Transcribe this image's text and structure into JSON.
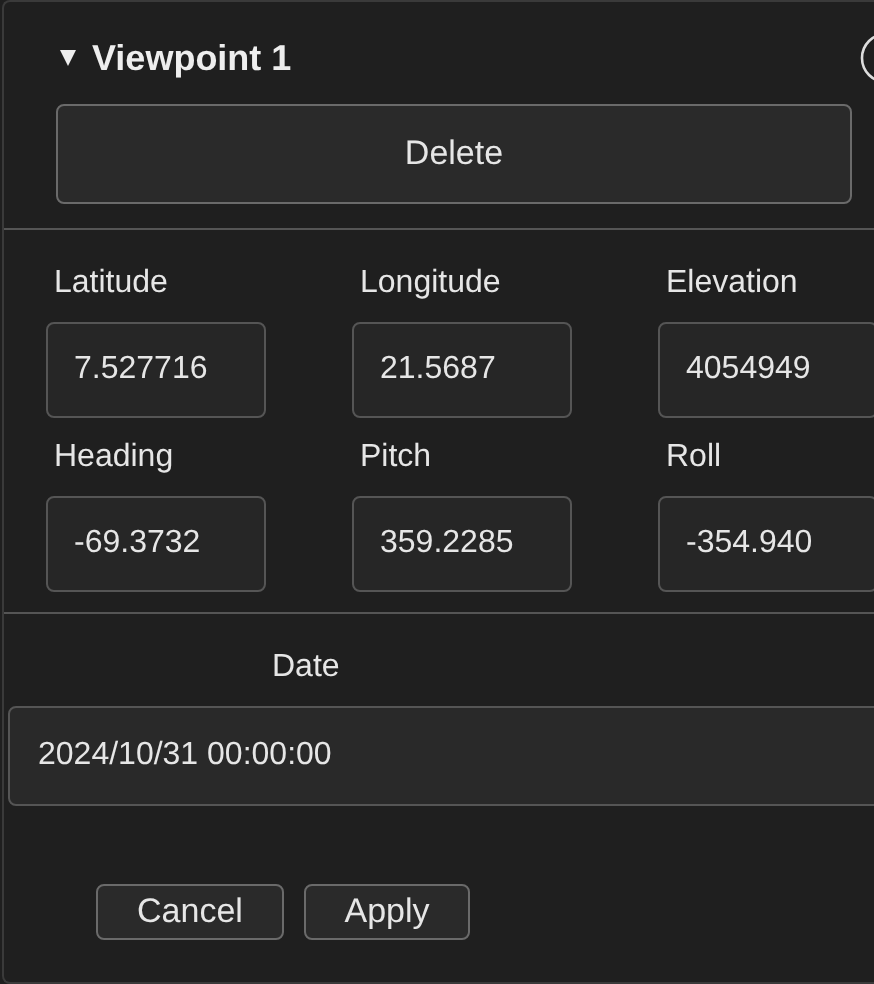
{
  "section": {
    "title": "Viewpoint 1",
    "expanded": true,
    "delete_button": "Delete"
  },
  "fields": [
    {
      "label": "Latitude",
      "value": "7.527716"
    },
    {
      "label": "Longitude",
      "value": "21.5687"
    },
    {
      "label": "Elevation",
      "value": "4054949"
    },
    {
      "label": "Heading",
      "value": "-69.3732"
    },
    {
      "label": "Pitch",
      "value": "359.2285"
    },
    {
      "label": "Roll",
      "value": "-354.940"
    }
  ],
  "date": {
    "label": "Date",
    "value": "2024/10/31 00:00:00"
  },
  "buttons": [
    "Cancel",
    "Apply"
  ]
}
